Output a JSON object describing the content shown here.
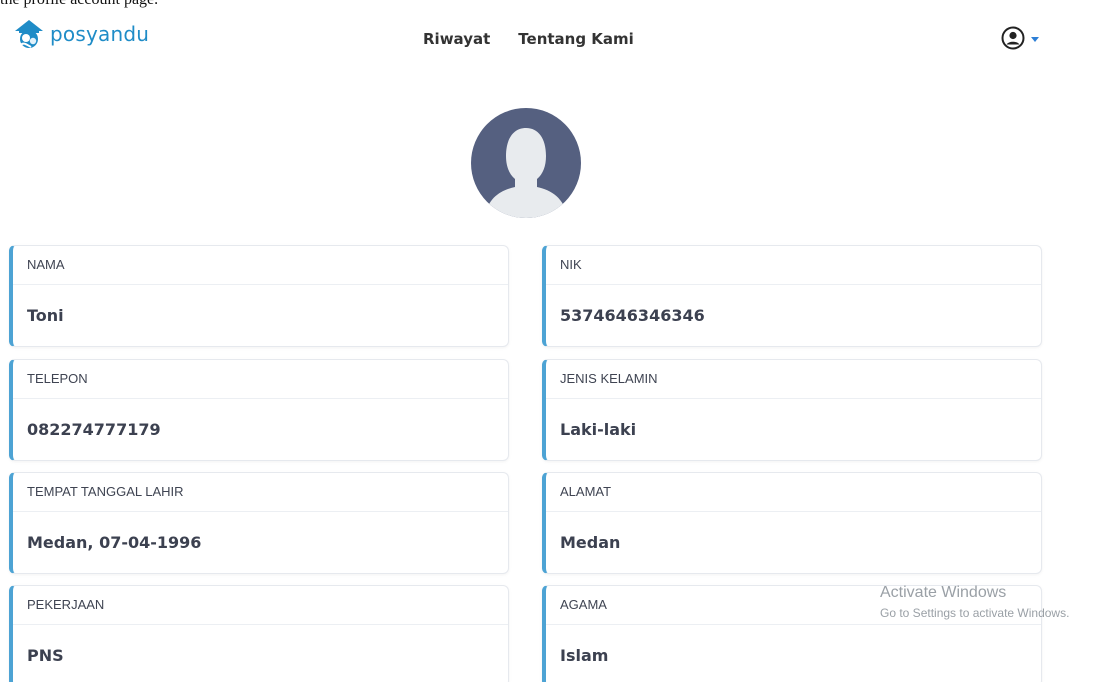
{
  "caption": "the profile account page.",
  "brand": {
    "name": "posyandu",
    "color": "#1f8cc7"
  },
  "nav": {
    "items": [
      {
        "label": "Riwayat"
      },
      {
        "label": "Tentang Kami"
      }
    ]
  },
  "user_menu": {
    "icon": "user-circle-icon",
    "caret": "caret-down-icon"
  },
  "avatar": {
    "icon": "user-silhouette-icon"
  },
  "profile": {
    "fields": [
      {
        "label": "NAMA",
        "value": "Toni"
      },
      {
        "label": "NIK",
        "value": "5374646346346"
      },
      {
        "label": "TELEPON",
        "value": "082274777179"
      },
      {
        "label": "JENIS KELAMIN",
        "value": "Laki-laki"
      },
      {
        "label": "TEMPAT TANGGAL LAHIR",
        "value": "Medan, 07-04-1996"
      },
      {
        "label": "ALAMAT",
        "value": "Medan"
      },
      {
        "label": "PEKERJAAN",
        "value": "PNS"
      },
      {
        "label": "AGAMA",
        "value": "Islam"
      }
    ]
  },
  "watermark": {
    "title": "Activate Windows",
    "subtitle": "Go to Settings to activate Windows."
  },
  "colors": {
    "accent": "#4da3d4",
    "avatar_bg": "#556080"
  }
}
